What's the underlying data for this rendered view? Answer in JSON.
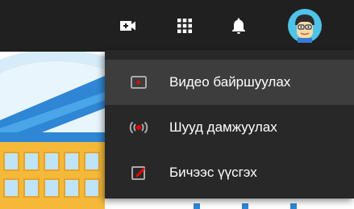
{
  "header": {
    "icons": [
      "video-camera-add-icon",
      "apps-grid-icon",
      "notifications-bell-icon",
      "avatar"
    ]
  },
  "create_menu": {
    "items": [
      {
        "label": "Видео байршуулах",
        "icon": "upload-video-icon",
        "highlighted": true
      },
      {
        "label": "Шууд дамжуулах",
        "icon": "live-broadcast-icon",
        "highlighted": false
      },
      {
        "label": "Бичээс үүсгэх",
        "icon": "create-post-icon",
        "highlighted": false
      }
    ]
  },
  "colors": {
    "topbar": "#202020",
    "menu_background": "#282828",
    "menu_hover": "#3d3d3d",
    "accent_red": "#ff0000",
    "avatar_background": "#4fc3e8"
  }
}
